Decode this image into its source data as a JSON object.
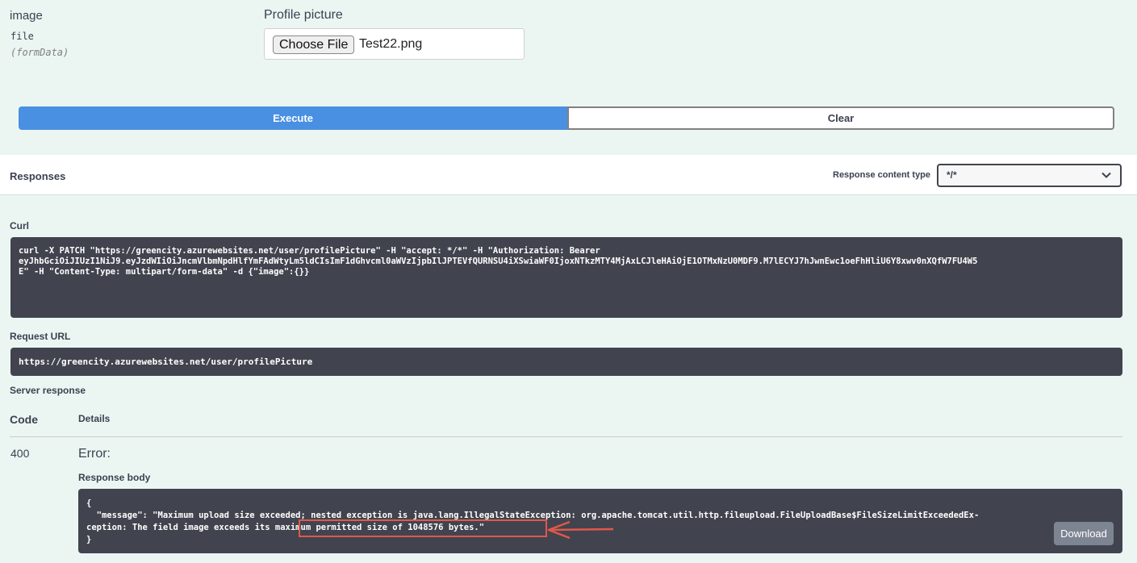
{
  "parameter": {
    "name": "image",
    "type": "file",
    "location": "(formData)",
    "description": "Profile picture",
    "file_input": {
      "button_label": "Choose File",
      "file_name": "Test22.png"
    }
  },
  "actions": {
    "execute_label": "Execute",
    "clear_label": "Clear"
  },
  "responses": {
    "title": "Responses",
    "content_type_label": "Response content type",
    "content_type_value": "*/*"
  },
  "curl": {
    "label": "Curl",
    "lines": [
      "curl -X PATCH \"https://greencity.azurewebsites.net/user/profilePicture\" -H \"accept: */*\" -H \"Authorization: Bearer",
      "eyJhbGciOiJIUzI1NiJ9.eyJzdWIiOiJncmVlbmNpdHlfYmFAdWtyLm5ldCIsImF1dGhvcml0aWVzIjpbIlJPTEVfQURNSU4iXSwiaWF0IjoxNTkzMTY4MjAxLCJleHAiOjE1OTMxNzU0MDF9.M7lECYJ7hJwnEwc1oeFhHliU6Y8xwv0nXQfW7FU4W5",
      "E\" -H \"Content-Type: multipart/form-data\" -d {\"image\":{}}"
    ]
  },
  "request_url": {
    "label": "Request URL",
    "value": "https://greencity.azurewebsites.net/user/profilePicture"
  },
  "server_response": {
    "label": "Server response",
    "code_header": "Code",
    "details_header": "Details",
    "status_code": "400",
    "error_title": "Error:",
    "body_label": "Response body",
    "body_lines": [
      "{",
      "  \"message\": \"Maximum upload size exceeded; nested exception is java.lang.IllegalStateException: org.apache.tomcat.util.http.fileupload.FileUploadBase$FileSizeLimitExceededEx-",
      "ception: The field image exceeds its maximum permitted size of 1048576 bytes.\"",
      "}"
    ],
    "download_label": "Download"
  },
  "annotation": {
    "highlight_color": "#e2574c"
  },
  "colors": {
    "background": "#ebf6f2",
    "execute": "#4990e2",
    "code_block": "#41444e",
    "download": "#7d8492"
  }
}
